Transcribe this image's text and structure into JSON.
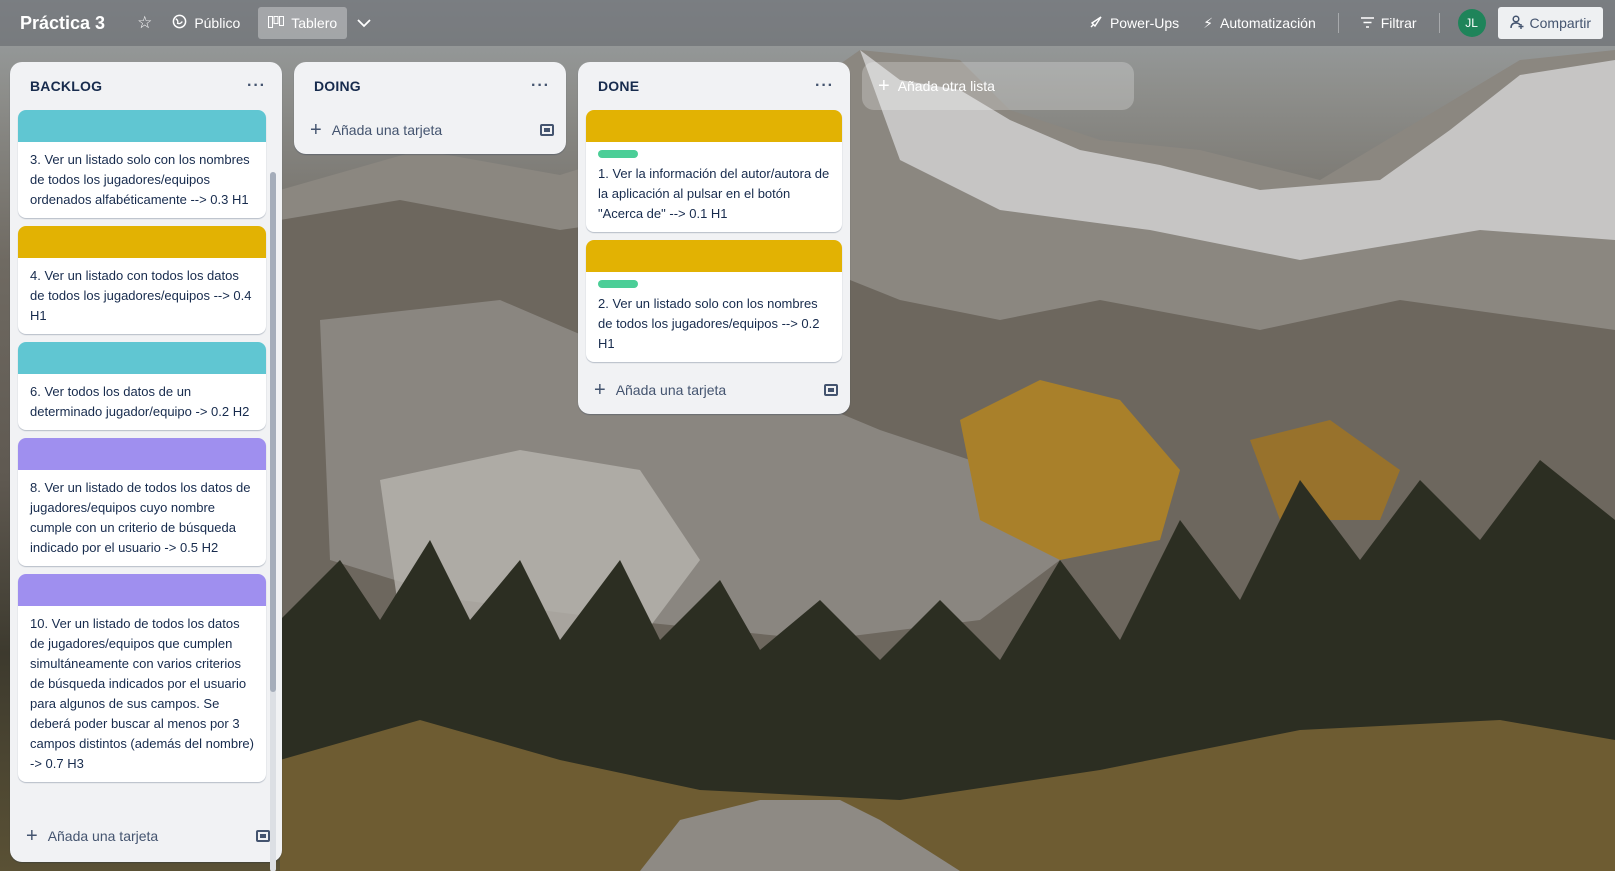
{
  "board": {
    "title": "Práctica 3"
  },
  "topbar": {
    "visibility_label": "Público",
    "view_label": "Tablero",
    "powerups_label": "Power-Ups",
    "automation_label": "Automatización",
    "filter_label": "Filtrar",
    "avatar_initials": "JL",
    "share_label": "Compartir"
  },
  "colors": {
    "cover_teal": "#60c6d2",
    "cover_yellow": "#e2b203",
    "cover_purple": "#9f8fef",
    "label_green": "#4bce97",
    "avatar_green": "#1f845a"
  },
  "lists": [
    {
      "title": "BACKLOG",
      "menu": "···",
      "add_label": "Añada una tarjeta",
      "cards": [
        {
          "cover": "teal",
          "text": "3. Ver un listado solo con los nombres de todos los jugadores/equipos ordenados alfabéticamente --> 0.3 H1"
        },
        {
          "cover": "yellow",
          "text": "4. Ver un listado con todos los datos de todos los jugadores/equipos --> 0.4 H1"
        },
        {
          "cover": "teal",
          "text": "6. Ver todos los datos de un determinado jugador/equipo -> 0.2 H2"
        },
        {
          "cover": "purple",
          "text": "8. Ver un listado de todos los datos de jugadores/equipos cuyo nombre cumple con un criterio de búsqueda indicado por el usuario -> 0.5 H2"
        },
        {
          "cover": "purple",
          "text": "10. Ver un listado de todos los datos de jugadores/equipos que cumplen simultáneamente con varios criterios de búsqueda indicados por el usuario para algunos de sus campos. Se deberá poder buscar al menos por 3 campos distintos (además del nombre) -> 0.7 H3"
        }
      ]
    },
    {
      "title": "DOING",
      "menu": "···",
      "add_label": "Añada una tarjeta",
      "cards": []
    },
    {
      "title": "DONE",
      "menu": "···",
      "add_label": "Añada una tarjeta",
      "cards": [
        {
          "cover": "yellow",
          "label": "green",
          "text": "1. Ver la información del autor/autora de la aplicación al pulsar en el botón \"Acerca de\" --> 0.1 H1"
        },
        {
          "cover": "yellow",
          "label": "green",
          "text": "2. Ver un listado solo con los nombres de todos los jugadores/equipos --> 0.2 H1"
        }
      ]
    }
  ],
  "add_list_label": "Añada otra lista",
  "icons": [
    "star-icon",
    "globe-icon",
    "board-icon",
    "chevron-down-icon",
    "rocket-icon",
    "bolt-icon",
    "filter-icon",
    "person-add-icon",
    "plus-icon",
    "template-icon",
    "dots-icon"
  ]
}
